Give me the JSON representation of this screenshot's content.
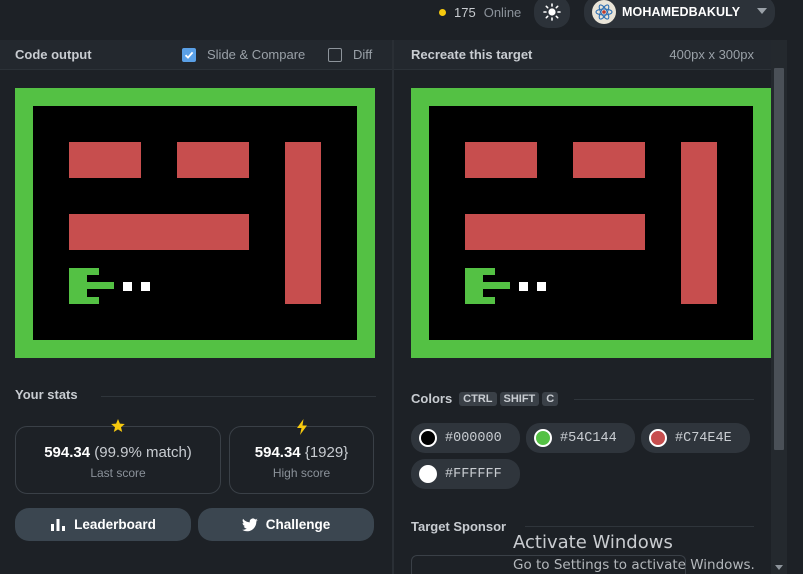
{
  "topbar": {
    "online_count": "175",
    "online_label": "Online",
    "username": "MOHAMEDBAKULY"
  },
  "left_panel": {
    "title": "Code output",
    "slide_compare": {
      "label": "Slide & Compare",
      "checked": true
    },
    "diff": {
      "label": "Diff",
      "checked": false
    }
  },
  "right_panel": {
    "title": "Recreate this target",
    "size": "400px x 300px"
  },
  "stats": {
    "title": "Your stats",
    "last": {
      "score": "594.34",
      "detail": "(99.9% match)",
      "label": "Last score",
      "icon": "star-icon"
    },
    "high": {
      "score": "594.34",
      "detail": "{1929}",
      "label": "High score",
      "icon": "lightning-icon"
    }
  },
  "buttons": {
    "leaderboard": "Leaderboard",
    "challenge": "Challenge"
  },
  "colors": {
    "title": "Colors",
    "shortcut_keys": [
      "CTRL",
      "SHIFT",
      "C"
    ],
    "swatches": [
      {
        "hex": "#000000"
      },
      {
        "hex": "#54C144"
      },
      {
        "hex": "#C74E4E"
      },
      {
        "hex": "#FFFFFF"
      }
    ]
  },
  "sponsor": {
    "title": "Target Sponsor"
  },
  "watermark": {
    "line1": "Activate Windows",
    "line2": "Go to Settings to activate Windows."
  },
  "palette": {
    "background": "#000000",
    "green": "#54c144",
    "red": "#c74e4e",
    "white": "#ffffff",
    "accent_blue": "#5aa0e6",
    "online_dot": "#f6c90e"
  }
}
